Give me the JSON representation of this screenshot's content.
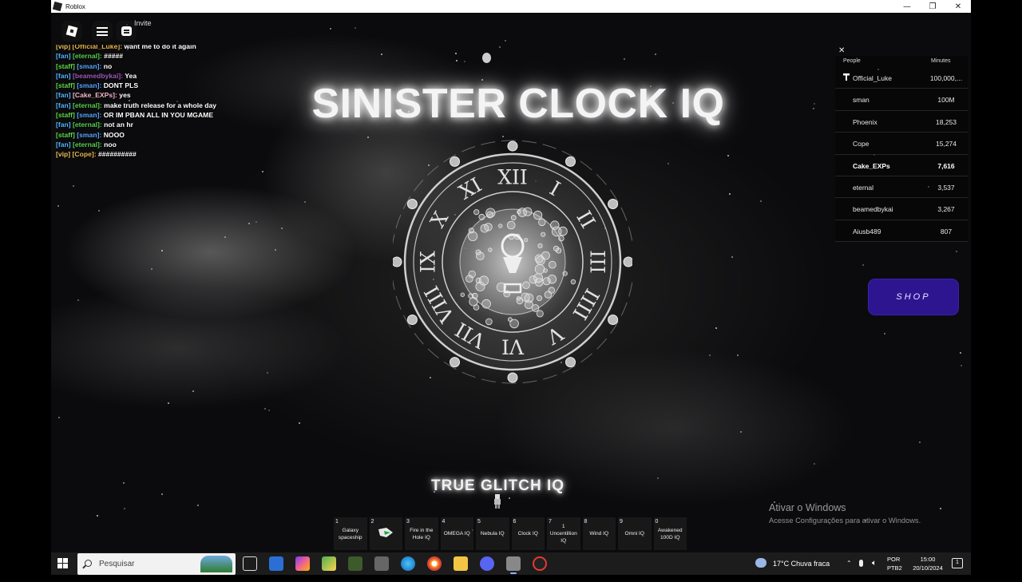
{
  "window": {
    "title": "Roblox",
    "controls": [
      "—",
      "❐",
      "✕"
    ]
  },
  "topbar": {
    "invite_label": "Invite"
  },
  "chat": [
    {
      "tag": "[vip]",
      "tag_color": "#e7c15a",
      "name": "[Official_Luke]:",
      "name_color": "#e9b44c",
      "msg": "want me to do it again"
    },
    {
      "tag": "[fan]",
      "tag_color": "#52b5ff",
      "name": "[eternal]:",
      "name_color": "#58d04f",
      "msg": "#####"
    },
    {
      "tag": "[staff]",
      "tag_color": "#61d84a",
      "name": "[sman]:",
      "name_color": "#58a6ff",
      "msg": "no"
    },
    {
      "tag": "[fan]",
      "tag_color": "#52b5ff",
      "name": "[beamedbykai]:",
      "name_color": "#9b59b6",
      "msg": "Yea"
    },
    {
      "tag": "[staff]",
      "tag_color": "#61d84a",
      "name": "[sman]:",
      "name_color": "#58a6ff",
      "msg": "DONT PLS"
    },
    {
      "tag": "[fan]",
      "tag_color": "#52b5ff",
      "name": "[Cake_EXPs]:",
      "name_color": "#f2b8c6",
      "msg": "yes"
    },
    {
      "tag": "[fan]",
      "tag_color": "#52b5ff",
      "name": "[eternal]:",
      "name_color": "#58d04f",
      "msg": "make truth release for a whole day"
    },
    {
      "tag": "[staff]",
      "tag_color": "#61d84a",
      "name": "[sman]:",
      "name_color": "#58a6ff",
      "msg": "OR IM PBAN ALL IN YOU MGAME"
    },
    {
      "tag": "[fan]",
      "tag_color": "#52b5ff",
      "name": "[eternal]:",
      "name_color": "#58d04f",
      "msg": "not an hr"
    },
    {
      "tag": "[staff]",
      "tag_color": "#61d84a",
      "name": "[sman]:",
      "name_color": "#58a6ff",
      "msg": "NOOO"
    },
    {
      "tag": "[fan]",
      "tag_color": "#52b5ff",
      "name": "[eternal]:",
      "name_color": "#58d04f",
      "msg": "noo"
    },
    {
      "tag": "[vip]",
      "tag_color": "#e7c15a",
      "name": "[Cope]:",
      "name_color": "#e9b44c",
      "msg": "##########"
    }
  ],
  "game_title": "SINISTER CLOCK IQ",
  "clock_numerals": [
    "XII",
    "I",
    "II",
    "III",
    "IIII",
    "V",
    "VI",
    "VII",
    "VIII",
    "IX",
    "X",
    "XI"
  ],
  "leaderboard": {
    "col_people": "People",
    "col_minutes": "Minutes",
    "rows": [
      {
        "name": "Official_Luke",
        "minutes": "100,000,...",
        "me": false,
        "badge": true
      },
      {
        "name": "sman",
        "minutes": "100M",
        "me": false,
        "badge": false
      },
      {
        "name": "Phoenix",
        "minutes": "18,253",
        "me": false,
        "badge": false
      },
      {
        "name": "Cope",
        "minutes": "15,274",
        "me": false,
        "badge": false
      },
      {
        "name": "Cake_EXPs",
        "minutes": "7,616",
        "me": true,
        "badge": false
      },
      {
        "name": "eternal",
        "minutes": "3,537",
        "me": false,
        "badge": false
      },
      {
        "name": "beamedbykai",
        "minutes": "3,267",
        "me": false,
        "badge": false
      },
      {
        "name": "Aiusb489",
        "minutes": "807",
        "me": false,
        "badge": false
      }
    ]
  },
  "shop_label": "SHOP",
  "equipped_label": "TRUE GLITCH IQ",
  "hotbar": [
    {
      "num": "1",
      "label": "Galaxy spaceship"
    },
    {
      "num": "2",
      "label": "",
      "icon": true
    },
    {
      "num": "3",
      "label": "Fire in the Hole IQ"
    },
    {
      "num": "4",
      "label": "OMEGA IQ"
    },
    {
      "num": "5",
      "label": "Nebula IQ"
    },
    {
      "num": "6",
      "label": "Clock IQ"
    },
    {
      "num": "7",
      "label": "1 Uncentillion IQ"
    },
    {
      "num": "8",
      "label": "Wind IQ"
    },
    {
      "num": "9",
      "label": "Omni IQ"
    },
    {
      "num": "0",
      "label": "Awakened 100D IQ"
    }
  ],
  "watermark": {
    "line1": "Ativar o Windows",
    "line2": "Acesse Configurações para ativar o Windows."
  },
  "taskbar": {
    "search_placeholder": "Pesquisar",
    "weather": "17°C  Chuva fraca",
    "lang1": "POR",
    "lang2": "PTB2",
    "time": "15:00",
    "date": "20/10/2024",
    "notif": "1"
  }
}
